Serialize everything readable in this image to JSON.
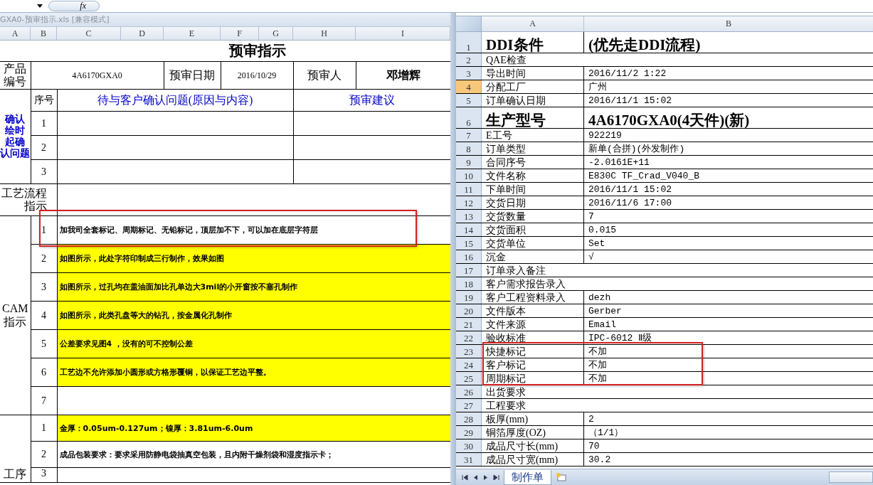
{
  "formula_bar": {
    "fx_label": "fx"
  },
  "left_window": {
    "title": "GXA0-预审指示.xls  [兼容模式]",
    "columns": [
      "A",
      "B",
      "C",
      "D",
      "E",
      "F",
      "G",
      "H",
      "I"
    ],
    "sheet": {
      "title": "预审指示",
      "product": {
        "label_lines": [
          "产品",
          "编号"
        ],
        "code": "4A6170GXA0",
        "date_label": "预审日期",
        "date": "2016/10/29",
        "reviewer_label": "预审人",
        "reviewer": "邓增辉"
      },
      "confirm": {
        "label_lines": [
          "确认",
          "绘时",
          "起确",
          "认问题"
        ],
        "index_header": "序号",
        "question_header": "待与客户确认问题(原因与内容)",
        "advice_header": "预审建议",
        "rows": [
          "1",
          "2",
          "3"
        ]
      },
      "process": {
        "label_lines": [
          "工艺流程",
          "指示"
        ]
      },
      "cam": {
        "label_lines": [
          "CAM",
          "指示"
        ],
        "rows": [
          {
            "number": "1",
            "text": "加我司全套标记、周期标记、无铅标记，顶层加不下，可以加在底层字符层",
            "highlighted": false
          },
          {
            "number": "2",
            "text": "如图所示，此处字符印制成三行制作，效果如图",
            "highlighted": true
          },
          {
            "number": "3",
            "text": "如图所示，过孔均在盖油面加比孔单边大3mil的小开窗按不塞孔制作",
            "highlighted": true
          },
          {
            "number": "4",
            "text": "如图所示，此类孔盘等大的钻孔，按金属化孔制作",
            "highlighted": true
          },
          {
            "number": "5",
            "text": "公差要求见图4 ，没有的可不控制公差",
            "highlighted": true
          },
          {
            "number": "6",
            "text": "工艺边不允许添加小圆形或方格形覆铜，以保证工艺边平整。",
            "highlighted": true
          },
          {
            "number": "7",
            "highlighted": false
          }
        ]
      },
      "step": {
        "label_lines": [
          "工序"
        ],
        "rows": [
          {
            "number": "1",
            "text": "金厚：0.05um-0.127um；镍厚：3.81um-6.0um",
            "highlighted": true
          },
          {
            "number": "2",
            "text": "成品包装要求：要求采用防静电袋抽真空包装，且内附干燥剂袋和湿度指示卡；",
            "highlighted": false
          },
          {
            "number": "3",
            "highlighted": false
          }
        ]
      }
    }
  },
  "right_window": {
    "columns": [
      "A",
      "B"
    ],
    "rows": [
      {
        "number": "1",
        "label": "DDI条件",
        "value": "(优先走DDI流程)",
        "kind": "large",
        "selected": false
      },
      {
        "number": "2",
        "label": "QAE检查",
        "kind": "span",
        "selected": false
      },
      {
        "number": "3",
        "label": "导出时间",
        "value": "2016/11/2 1:22",
        "kind": "normal",
        "selected": false
      },
      {
        "number": "4",
        "label": "分配工厂",
        "value": "广州",
        "kind": "normal",
        "selected": true
      },
      {
        "number": "5",
        "label": "订单确认日期",
        "value": "2016/11/1 15:02",
        "kind": "normal",
        "selected": false
      },
      {
        "number": "6",
        "label": "生产型号",
        "value": "4A6170GXA0(4天件)(新)",
        "kind": "large",
        "selected": false
      },
      {
        "number": "7",
        "label": "E工号",
        "value": "922219",
        "kind": "normal",
        "selected": false
      },
      {
        "number": "8",
        "label": "订单类型",
        "value": "新单(合拼)(外发制作)",
        "kind": "normal",
        "selected": false
      },
      {
        "number": "9",
        "label": "合同序号",
        "value": "-2.0161E+11",
        "kind": "normal",
        "selected": false
      },
      {
        "number": "10",
        "label": "文件名称",
        "value": "E830C TF_Crad_V040_B",
        "kind": "normal",
        "selected": false
      },
      {
        "number": "11",
        "label": "下单时间",
        "value": "2016/11/1 15:02",
        "kind": "normal",
        "selected": false
      },
      {
        "number": "12",
        "label": "交货日期",
        "value": "2016/11/6 17:00",
        "kind": "normal",
        "selected": false
      },
      {
        "number": "13",
        "label": "交货数量",
        "value": "7",
        "kind": "normal",
        "selected": false
      },
      {
        "number": "14",
        "label": "交货面积",
        "value": "0.015",
        "kind": "normal",
        "selected": false
      },
      {
        "number": "15",
        "label": "交货单位",
        "value": "Set",
        "kind": "normal",
        "selected": false
      },
      {
        "number": "16",
        "label": "沉金",
        "value": "√",
        "kind": "normal",
        "selected": false
      },
      {
        "number": "17",
        "label": "订单录入备注",
        "kind": "span",
        "selected": false
      },
      {
        "number": "18",
        "label": "客户需求报告录入",
        "kind": "span",
        "selected": false
      },
      {
        "number": "19",
        "label": "客户工程资料录入",
        "value": "dezh",
        "kind": "normal",
        "selected": false
      },
      {
        "number": "20",
        "label": "文件版本",
        "value": "Gerber",
        "kind": "normal",
        "selected": false
      },
      {
        "number": "21",
        "label": "文件来源",
        "value": "Email",
        "kind": "normal",
        "selected": false
      },
      {
        "number": "22",
        "label": "验收标准",
        "value": "IPC-6012 Ⅱ级",
        "kind": "normal",
        "selected": false
      },
      {
        "number": "23",
        "label": "快捷标记",
        "value": "不加",
        "kind": "normal",
        "selected": false
      },
      {
        "number": "24",
        "label": "客户标记",
        "value": "不加",
        "kind": "normal",
        "selected": false
      },
      {
        "number": "25",
        "label": "周期标记",
        "value": "不加",
        "kind": "normal",
        "selected": false
      },
      {
        "number": "26",
        "label": "出货要求",
        "kind": "span",
        "selected": false
      },
      {
        "number": "27",
        "label": "工程要求",
        "kind": "span",
        "selected": false
      },
      {
        "number": "28",
        "label": "板厚(mm)",
        "value": "2",
        "kind": "normal",
        "selected": false
      },
      {
        "number": "29",
        "label": "铜箔厚度(OZ)",
        "value": "（1/1）",
        "kind": "normal",
        "selected": false
      },
      {
        "number": "30",
        "label": "成品尺寸长(mm)",
        "value": "70",
        "kind": "normal",
        "selected": false
      },
      {
        "number": "31",
        "label": "成品尺寸宽(mm)",
        "value": "30.2",
        "kind": "normal",
        "selected": false
      }
    ],
    "sheet_tabs": [
      {
        "label": "制作单",
        "selected": true
      }
    ]
  }
}
